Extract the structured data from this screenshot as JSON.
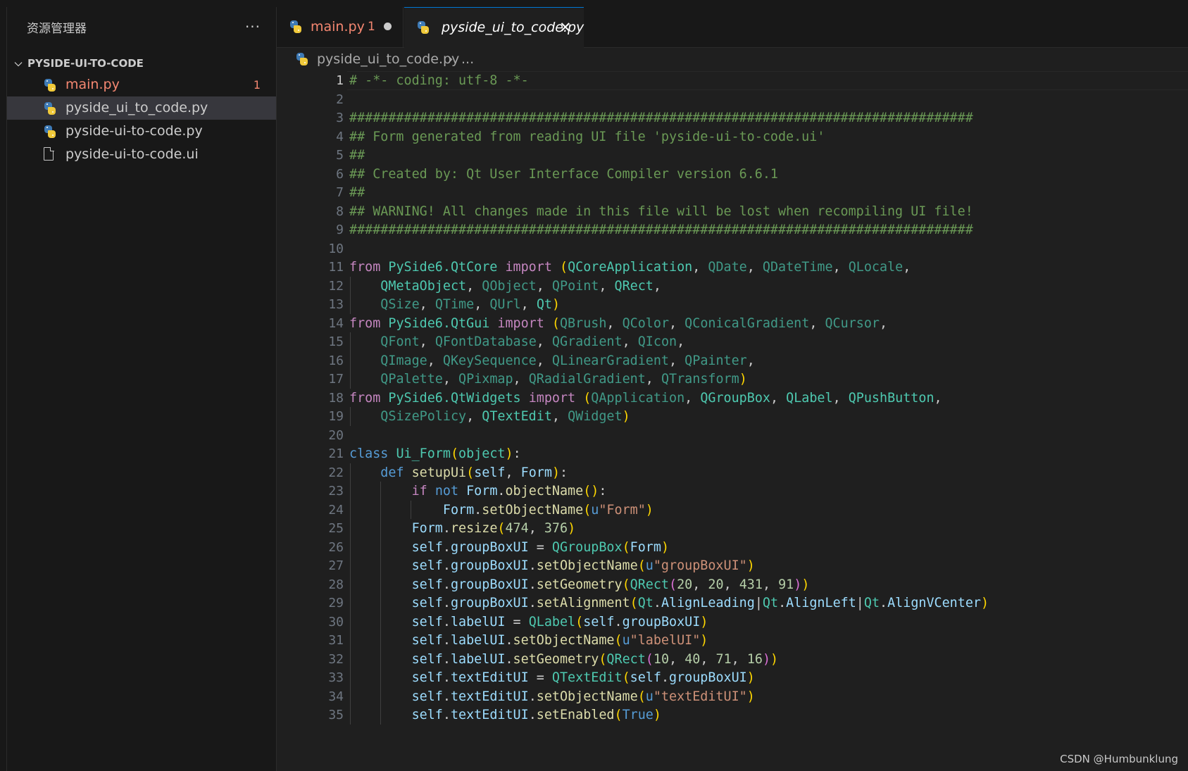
{
  "explorer": {
    "header": "资源管理器",
    "more_label": "···",
    "folder": "PYSIDE-UI-TO-CODE",
    "files": [
      {
        "name": "main.py",
        "icon": "python-file-icon",
        "badge": "1",
        "state": "error"
      },
      {
        "name": "pyside_ui_to_code.py",
        "icon": "python-file-icon",
        "badge": "",
        "state": "selected"
      },
      {
        "name": "pyside-ui-to-code.py",
        "icon": "python-file-icon",
        "badge": "",
        "state": "normal"
      },
      {
        "name": "pyside-ui-to-code.ui",
        "icon": "generic-file-icon",
        "badge": "",
        "state": "normal"
      }
    ]
  },
  "tabs": [
    {
      "label": "main.py",
      "problems": "1",
      "dirty": true,
      "active": false
    },
    {
      "label": "pyside_ui_to_code.py",
      "close": "✕",
      "active": true
    }
  ],
  "breadcrumb": {
    "file": "pyside_ui_to_code.py",
    "separator": "›",
    "more": "..."
  },
  "editor": {
    "active_line": 1,
    "lines": [
      [
        [
          "comment",
          "# -*- coding: utf-8 -*-"
        ]
      ],
      [],
      [
        [
          "comment",
          "################################################################################"
        ]
      ],
      [
        [
          "comment",
          "## Form generated from reading UI file 'pyside-ui-to-code.ui'"
        ]
      ],
      [
        [
          "comment",
          "##"
        ]
      ],
      [
        [
          "comment",
          "## Created by: Qt User Interface Compiler version 6.6.1"
        ]
      ],
      [
        [
          "comment",
          "##"
        ]
      ],
      [
        [
          "comment",
          "## WARNING! All changes made in this file will be lost when recompiling UI file!"
        ]
      ],
      [
        [
          "comment",
          "################################################################################"
        ]
      ],
      [],
      [
        [
          "keyword",
          "from"
        ],
        [
          "plain",
          " "
        ],
        [
          "module",
          "PySide6.QtCore"
        ],
        [
          "plain",
          " "
        ],
        [
          "keyword",
          "import"
        ],
        [
          "plain",
          " "
        ],
        [
          "bracket1",
          "("
        ],
        [
          "class",
          "QCoreApplication"
        ],
        [
          "punct",
          ", "
        ],
        [
          "class-dim",
          "QDate"
        ],
        [
          "punct",
          ", "
        ],
        [
          "class-dim",
          "QDateTime"
        ],
        [
          "punct",
          ", "
        ],
        [
          "class-dim",
          "QLocale"
        ],
        [
          "punct",
          ","
        ]
      ],
      [
        [
          "plain",
          "    "
        ],
        [
          "class",
          "QMetaObject"
        ],
        [
          "punct",
          ", "
        ],
        [
          "class-dim",
          "QObject"
        ],
        [
          "punct",
          ", "
        ],
        [
          "class-dim",
          "QPoint"
        ],
        [
          "punct",
          ", "
        ],
        [
          "class",
          "QRect"
        ],
        [
          "punct",
          ","
        ]
      ],
      [
        [
          "plain",
          "    "
        ],
        [
          "class-dim",
          "QSize"
        ],
        [
          "punct",
          ", "
        ],
        [
          "class-dim",
          "QTime"
        ],
        [
          "punct",
          ", "
        ],
        [
          "class-dim",
          "QUrl"
        ],
        [
          "punct",
          ", "
        ],
        [
          "class",
          "Qt"
        ],
        [
          "bracket1",
          ")"
        ]
      ],
      [
        [
          "keyword",
          "from"
        ],
        [
          "plain",
          " "
        ],
        [
          "module",
          "PySide6.QtGui"
        ],
        [
          "plain",
          " "
        ],
        [
          "keyword",
          "import"
        ],
        [
          "plain",
          " "
        ],
        [
          "bracket1",
          "("
        ],
        [
          "class-dim",
          "QBrush"
        ],
        [
          "punct",
          ", "
        ],
        [
          "class-dim",
          "QColor"
        ],
        [
          "punct",
          ", "
        ],
        [
          "class-dim",
          "QConicalGradient"
        ],
        [
          "punct",
          ", "
        ],
        [
          "class-dim",
          "QCursor"
        ],
        [
          "punct",
          ","
        ]
      ],
      [
        [
          "plain",
          "    "
        ],
        [
          "class-dim",
          "QFont"
        ],
        [
          "punct",
          ", "
        ],
        [
          "class-dim",
          "QFontDatabase"
        ],
        [
          "punct",
          ", "
        ],
        [
          "class-dim",
          "QGradient"
        ],
        [
          "punct",
          ", "
        ],
        [
          "class-dim",
          "QIcon"
        ],
        [
          "punct",
          ","
        ]
      ],
      [
        [
          "plain",
          "    "
        ],
        [
          "class-dim",
          "QImage"
        ],
        [
          "punct",
          ", "
        ],
        [
          "class-dim",
          "QKeySequence"
        ],
        [
          "punct",
          ", "
        ],
        [
          "class-dim",
          "QLinearGradient"
        ],
        [
          "punct",
          ", "
        ],
        [
          "class-dim",
          "QPainter"
        ],
        [
          "punct",
          ","
        ]
      ],
      [
        [
          "plain",
          "    "
        ],
        [
          "class-dim",
          "QPalette"
        ],
        [
          "punct",
          ", "
        ],
        [
          "class-dim",
          "QPixmap"
        ],
        [
          "punct",
          ", "
        ],
        [
          "class-dim",
          "QRadialGradient"
        ],
        [
          "punct",
          ", "
        ],
        [
          "class-dim",
          "QTransform"
        ],
        [
          "bracket1",
          ")"
        ]
      ],
      [
        [
          "keyword",
          "from"
        ],
        [
          "plain",
          " "
        ],
        [
          "module",
          "PySide6.QtWidgets"
        ],
        [
          "plain",
          " "
        ],
        [
          "keyword",
          "import"
        ],
        [
          "plain",
          " "
        ],
        [
          "bracket1",
          "("
        ],
        [
          "class-dim",
          "QApplication"
        ],
        [
          "punct",
          ", "
        ],
        [
          "class",
          "QGroupBox"
        ],
        [
          "punct",
          ", "
        ],
        [
          "class",
          "QLabel"
        ],
        [
          "punct",
          ", "
        ],
        [
          "class",
          "QPushButton"
        ],
        [
          "punct",
          ","
        ]
      ],
      [
        [
          "plain",
          "    "
        ],
        [
          "class-dim",
          "QSizePolicy"
        ],
        [
          "punct",
          ", "
        ],
        [
          "class",
          "QTextEdit"
        ],
        [
          "punct",
          ", "
        ],
        [
          "class-dim",
          "QWidget"
        ],
        [
          "bracket1",
          ")"
        ]
      ],
      [],
      [
        [
          "storage",
          "class"
        ],
        [
          "plain",
          " "
        ],
        [
          "class",
          "Ui_Form"
        ],
        [
          "bracket1",
          "("
        ],
        [
          "class",
          "object"
        ],
        [
          "bracket1",
          ")"
        ],
        [
          "punct",
          ":"
        ]
      ],
      [
        [
          "plain",
          "    "
        ],
        [
          "storage",
          "def"
        ],
        [
          "plain",
          " "
        ],
        [
          "function",
          "setupUi"
        ],
        [
          "bracket1",
          "("
        ],
        [
          "variable",
          "self"
        ],
        [
          "punct",
          ", "
        ],
        [
          "variable",
          "Form"
        ],
        [
          "bracket1",
          ")"
        ],
        [
          "punct",
          ":"
        ]
      ],
      [
        [
          "plain",
          "        "
        ],
        [
          "keyword",
          "if"
        ],
        [
          "plain",
          " "
        ],
        [
          "storage",
          "not"
        ],
        [
          "plain",
          " "
        ],
        [
          "variable",
          "Form"
        ],
        [
          "punct",
          "."
        ],
        [
          "function",
          "objectName"
        ],
        [
          "bracket1",
          "("
        ],
        [
          "bracket1",
          ")"
        ],
        [
          "punct",
          ":"
        ]
      ],
      [
        [
          "plain",
          "            "
        ],
        [
          "variable",
          "Form"
        ],
        [
          "punct",
          "."
        ],
        [
          "function",
          "setObjectName"
        ],
        [
          "bracket1",
          "("
        ],
        [
          "storage",
          "u"
        ],
        [
          "string",
          "\"Form\""
        ],
        [
          "bracket1",
          ")"
        ]
      ],
      [
        [
          "plain",
          "        "
        ],
        [
          "variable",
          "Form"
        ],
        [
          "punct",
          "."
        ],
        [
          "function",
          "resize"
        ],
        [
          "bracket1",
          "("
        ],
        [
          "number",
          "474"
        ],
        [
          "punct",
          ", "
        ],
        [
          "number",
          "376"
        ],
        [
          "bracket1",
          ")"
        ]
      ],
      [
        [
          "plain",
          "        "
        ],
        [
          "variable",
          "self"
        ],
        [
          "punct",
          "."
        ],
        [
          "variable",
          "groupBoxUI"
        ],
        [
          "punct",
          " = "
        ],
        [
          "class",
          "QGroupBox"
        ],
        [
          "bracket1",
          "("
        ],
        [
          "variable",
          "Form"
        ],
        [
          "bracket1",
          ")"
        ]
      ],
      [
        [
          "plain",
          "        "
        ],
        [
          "variable",
          "self"
        ],
        [
          "punct",
          "."
        ],
        [
          "variable",
          "groupBoxUI"
        ],
        [
          "punct",
          "."
        ],
        [
          "function",
          "setObjectName"
        ],
        [
          "bracket1",
          "("
        ],
        [
          "storage",
          "u"
        ],
        [
          "string",
          "\"groupBoxUI\""
        ],
        [
          "bracket1",
          ")"
        ]
      ],
      [
        [
          "plain",
          "        "
        ],
        [
          "variable",
          "self"
        ],
        [
          "punct",
          "."
        ],
        [
          "variable",
          "groupBoxUI"
        ],
        [
          "punct",
          "."
        ],
        [
          "function",
          "setGeometry"
        ],
        [
          "bracket1",
          "("
        ],
        [
          "class",
          "QRect"
        ],
        [
          "bracket2",
          "("
        ],
        [
          "number",
          "20"
        ],
        [
          "punct",
          ", "
        ],
        [
          "number",
          "20"
        ],
        [
          "punct",
          ", "
        ],
        [
          "number",
          "431"
        ],
        [
          "punct",
          ", "
        ],
        [
          "number",
          "91"
        ],
        [
          "bracket2",
          ")"
        ],
        [
          "bracket1",
          ")"
        ]
      ],
      [
        [
          "plain",
          "        "
        ],
        [
          "variable",
          "self"
        ],
        [
          "punct",
          "."
        ],
        [
          "variable",
          "groupBoxUI"
        ],
        [
          "punct",
          "."
        ],
        [
          "function",
          "setAlignment"
        ],
        [
          "bracket1",
          "("
        ],
        [
          "class",
          "Qt"
        ],
        [
          "punct",
          "."
        ],
        [
          "variable",
          "AlignLeading"
        ],
        [
          "punct",
          "|"
        ],
        [
          "class",
          "Qt"
        ],
        [
          "punct",
          "."
        ],
        [
          "variable",
          "AlignLeft"
        ],
        [
          "punct",
          "|"
        ],
        [
          "class",
          "Qt"
        ],
        [
          "punct",
          "."
        ],
        [
          "variable",
          "AlignVCenter"
        ],
        [
          "bracket1",
          ")"
        ]
      ],
      [
        [
          "plain",
          "        "
        ],
        [
          "variable",
          "self"
        ],
        [
          "punct",
          "."
        ],
        [
          "variable",
          "labelUI"
        ],
        [
          "punct",
          " = "
        ],
        [
          "class",
          "QLabel"
        ],
        [
          "bracket1",
          "("
        ],
        [
          "variable",
          "self"
        ],
        [
          "punct",
          "."
        ],
        [
          "variable",
          "groupBoxUI"
        ],
        [
          "bracket1",
          ")"
        ]
      ],
      [
        [
          "plain",
          "        "
        ],
        [
          "variable",
          "self"
        ],
        [
          "punct",
          "."
        ],
        [
          "variable",
          "labelUI"
        ],
        [
          "punct",
          "."
        ],
        [
          "function",
          "setObjectName"
        ],
        [
          "bracket1",
          "("
        ],
        [
          "storage",
          "u"
        ],
        [
          "string",
          "\"labelUI\""
        ],
        [
          "bracket1",
          ")"
        ]
      ],
      [
        [
          "plain",
          "        "
        ],
        [
          "variable",
          "self"
        ],
        [
          "punct",
          "."
        ],
        [
          "variable",
          "labelUI"
        ],
        [
          "punct",
          "."
        ],
        [
          "function",
          "setGeometry"
        ],
        [
          "bracket1",
          "("
        ],
        [
          "class",
          "QRect"
        ],
        [
          "bracket2",
          "("
        ],
        [
          "number",
          "10"
        ],
        [
          "punct",
          ", "
        ],
        [
          "number",
          "40"
        ],
        [
          "punct",
          ", "
        ],
        [
          "number",
          "71"
        ],
        [
          "punct",
          ", "
        ],
        [
          "number",
          "16"
        ],
        [
          "bracket2",
          ")"
        ],
        [
          "bracket1",
          ")"
        ]
      ],
      [
        [
          "plain",
          "        "
        ],
        [
          "variable",
          "self"
        ],
        [
          "punct",
          "."
        ],
        [
          "variable",
          "textEditUI"
        ],
        [
          "punct",
          " = "
        ],
        [
          "class",
          "QTextEdit"
        ],
        [
          "bracket1",
          "("
        ],
        [
          "variable",
          "self"
        ],
        [
          "punct",
          "."
        ],
        [
          "variable",
          "groupBoxUI"
        ],
        [
          "bracket1",
          ")"
        ]
      ],
      [
        [
          "plain",
          "        "
        ],
        [
          "variable",
          "self"
        ],
        [
          "punct",
          "."
        ],
        [
          "variable",
          "textEditUI"
        ],
        [
          "punct",
          "."
        ],
        [
          "function",
          "setObjectName"
        ],
        [
          "bracket1",
          "("
        ],
        [
          "storage",
          "u"
        ],
        [
          "string",
          "\"textEditUI\""
        ],
        [
          "bracket1",
          ")"
        ]
      ],
      [
        [
          "plain",
          "        "
        ],
        [
          "variable",
          "self"
        ],
        [
          "punct",
          "."
        ],
        [
          "variable",
          "textEditUI"
        ],
        [
          "punct",
          "."
        ],
        [
          "function",
          "setEnabled"
        ],
        [
          "bracket1",
          "("
        ],
        [
          "storage",
          "True"
        ],
        [
          "bracket1",
          ")"
        ]
      ]
    ]
  },
  "watermark": "CSDN @Humbunklung",
  "colors": {
    "background": "#1f1f1f",
    "sidebar": "#181818",
    "selection": "#37373d",
    "error": "#f48771",
    "accent": "#0078d4"
  }
}
